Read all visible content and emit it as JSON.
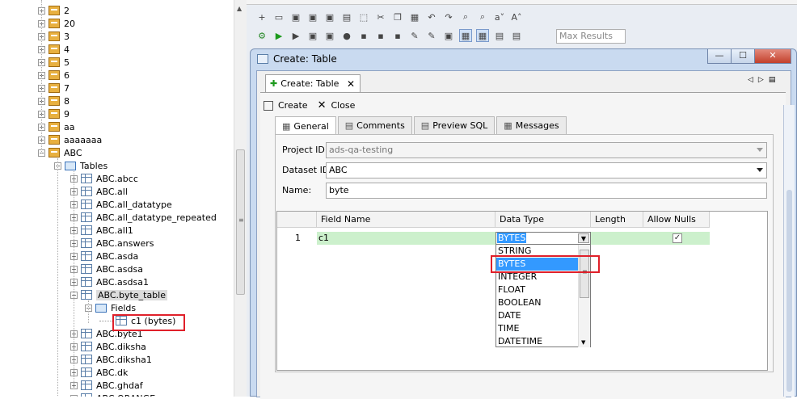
{
  "tree": {
    "items": [
      {
        "label": "2",
        "type": "db"
      },
      {
        "label": "20",
        "type": "db"
      },
      {
        "label": "3",
        "type": "db"
      },
      {
        "label": "4",
        "type": "db"
      },
      {
        "label": "5",
        "type": "db"
      },
      {
        "label": "6",
        "type": "db"
      },
      {
        "label": "7",
        "type": "db"
      },
      {
        "label": "8",
        "type": "db"
      },
      {
        "label": "9",
        "type": "db"
      },
      {
        "label": "aa",
        "type": "db"
      },
      {
        "label": "aaaaaaa",
        "type": "db"
      },
      {
        "label": "ABC",
        "type": "db",
        "expanded": true
      },
      {
        "label": "Tables",
        "type": "folder",
        "expanded": true
      },
      {
        "label": "ABC.abcc",
        "type": "table"
      },
      {
        "label": "ABC.all",
        "type": "table"
      },
      {
        "label": "ABC.all_datatype",
        "type": "table"
      },
      {
        "label": "ABC.all_datatype_repeated",
        "type": "table"
      },
      {
        "label": "ABC.all1",
        "type": "table"
      },
      {
        "label": "ABC.answers",
        "type": "table"
      },
      {
        "label": "ABC.asda",
        "type": "table"
      },
      {
        "label": "ABC.asdsa",
        "type": "table"
      },
      {
        "label": "ABC.asdsa1",
        "type": "table"
      },
      {
        "label": "ABC.byte_table",
        "type": "table",
        "expanded": true,
        "selected": true
      },
      {
        "label": "Fields",
        "type": "folder",
        "expanded": true
      },
      {
        "label": "c1 (bytes)",
        "type": "field",
        "highlighted": true
      },
      {
        "label": "ABC.byte1",
        "type": "table"
      },
      {
        "label": "ABC.diksha",
        "type": "table"
      },
      {
        "label": "ABC.diksha1",
        "type": "table"
      },
      {
        "label": "ABC.dk",
        "type": "table"
      },
      {
        "label": "ABC.ghdaf",
        "type": "table"
      },
      {
        "label": "ABC.ORANGE",
        "type": "table"
      }
    ]
  },
  "toolbar": {
    "max_results_placeholder": "Max Results"
  },
  "dialog": {
    "title": "Create: Table",
    "editor_tab": "Create: Table",
    "actions": {
      "create": "Create",
      "close": "Close"
    },
    "tabs": [
      "General",
      "Comments",
      "Preview SQL",
      "Messages"
    ],
    "form": {
      "project_label": "Project ID:",
      "project_value": "ads-qa-testing",
      "dataset_label": "Dataset ID:",
      "dataset_value": "ABC",
      "name_label": "Name:",
      "name_value": "byte"
    },
    "grid": {
      "headers": [
        "Field Name",
        "Data Type",
        "Length",
        "Allow Nulls"
      ],
      "rows": [
        {
          "num": "1",
          "field": "c1",
          "type": "BYTES",
          "length": "",
          "allow_nulls": true
        }
      ]
    },
    "datatype_options": [
      "STRING",
      "BYTES",
      "INTEGER",
      "FLOAT",
      "BOOLEAN",
      "DATE",
      "TIME",
      "DATETIME"
    ],
    "datatype_selected": "BYTES"
  },
  "colors": {
    "highlight_box": "#e0202a",
    "row_green": "#ccf0cc",
    "selection_blue": "#3399ff"
  }
}
